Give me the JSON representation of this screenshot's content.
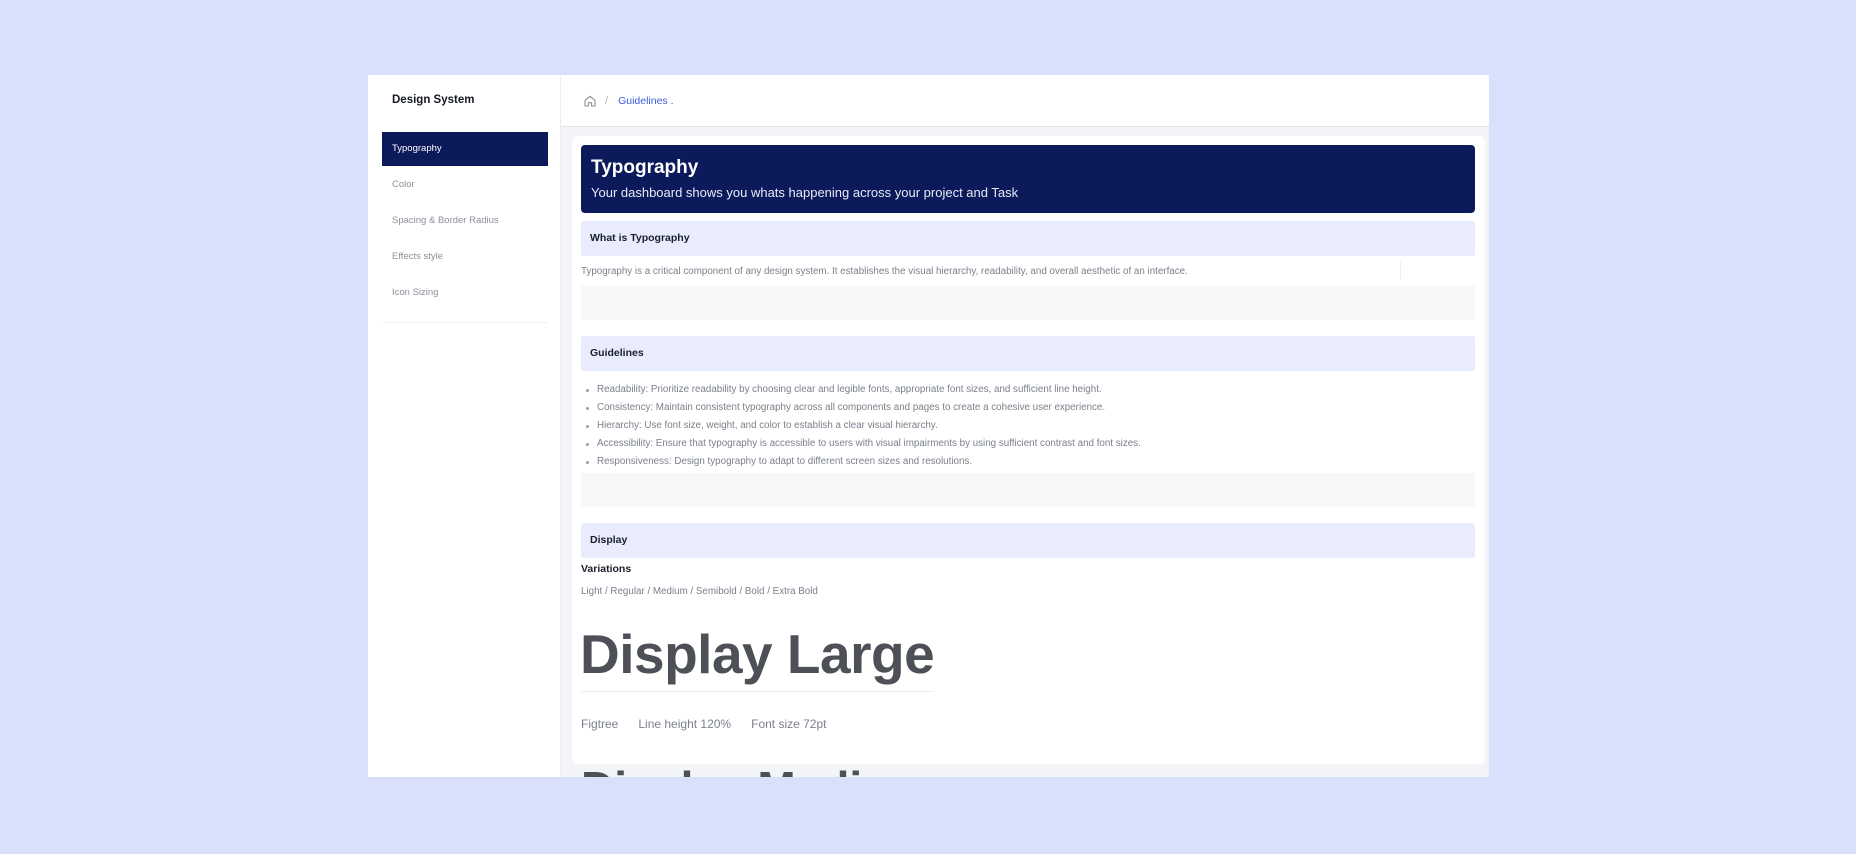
{
  "sidebar": {
    "brand": "Design System",
    "items": [
      {
        "label": "Typography",
        "active": true
      },
      {
        "label": "Color",
        "active": false
      },
      {
        "label": "Spacing & Border Radius",
        "active": false
      },
      {
        "label": "Effects style",
        "active": false
      },
      {
        "label": "Icon Sizing",
        "active": false
      }
    ]
  },
  "breadcrumb": {
    "home_icon": "home-icon",
    "separator": "/",
    "current": "Guidelines ."
  },
  "hero": {
    "title": "Typography",
    "subtitle": "Your dashboard shows you whats happening across your project and Task"
  },
  "what_is": {
    "heading": "What is Typography",
    "text": "Typography is a critical component of any design system. It establishes the visual hierarchy, readability, and overall aesthetic of an interface."
  },
  "guidelines": {
    "heading": "Guidelines",
    "items": [
      "Readability: Prioritize readability by choosing clear and legible fonts, appropriate font sizes, and sufficient line height.",
      "Consistency: Maintain consistent typography across all components and pages to create a cohesive user experience.",
      "Hierarchy: Use font size, weight, and color to establish a clear visual hierarchy.",
      "Accessibility: Ensure that typography is accessible to users with visual impairments by using sufficient contrast and font sizes.",
      "Responsiveness: Design typography to adapt to different screen sizes and resolutions."
    ]
  },
  "display": {
    "heading": "Display",
    "variations_title": "Variations",
    "variations": "Light / Regular / Medium / Semibold / Bold / Extra Bold",
    "large_sample": "Display Large",
    "font": "Figtree",
    "line_height": "Line height 120%",
    "font_size": "Font size 72pt",
    "medium_sample": "Display Medium"
  },
  "colors": {
    "page_bg": "#d9e0fb",
    "navy": "#0c1a5b",
    "section_head_bg": "#e8ecfc",
    "link": "#3b5bdb"
  }
}
